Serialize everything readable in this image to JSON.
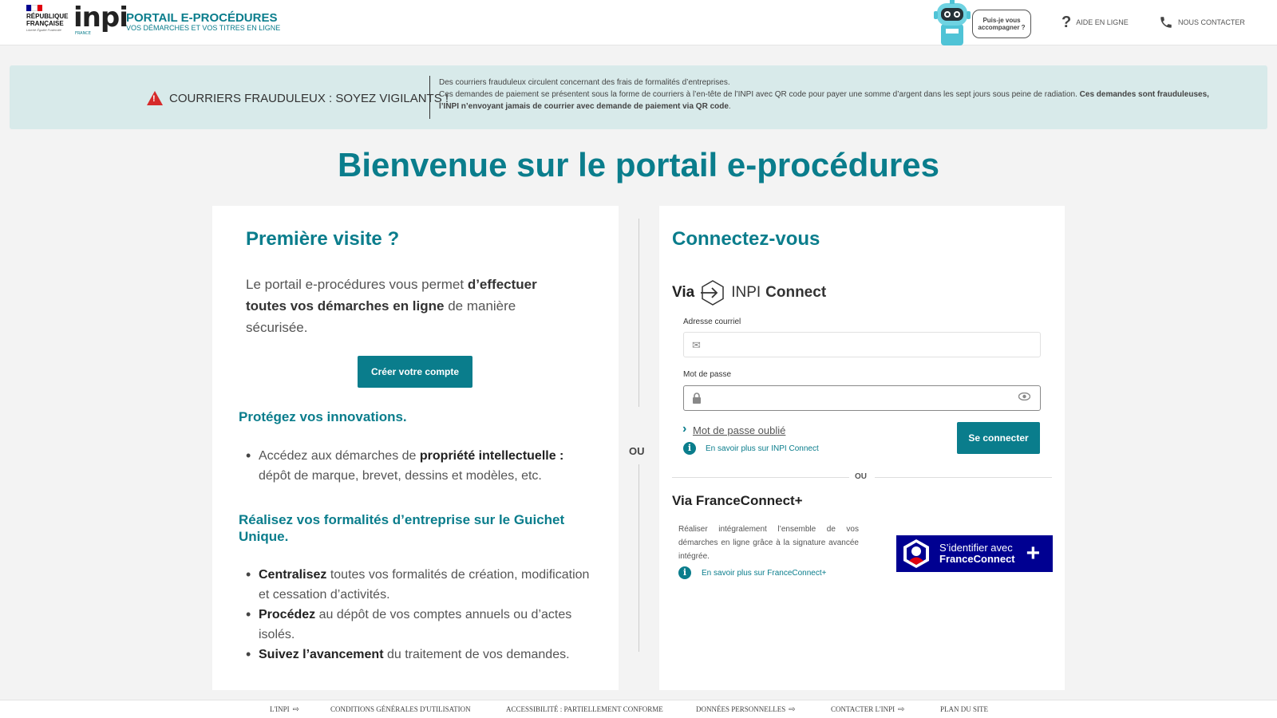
{
  "header": {
    "republique_line1": "RÉPUBLIQUE",
    "republique_line2": "FRANÇAISE",
    "motto": "Liberté Égalité Fraternité",
    "logo_text": "inpi",
    "logo_sub": "FRANCE",
    "portal_title": "PORTAIL E-PROCÉDURES",
    "portal_subtitle": "VOS DÉMARCHES ET VOS TITRES EN LIGNE",
    "assistant_bubble": "Puis-je vous accompagner ?",
    "help_link": "AIDE EN LIGNE",
    "contact_link": "NOUS CONTACTER",
    "help_icon": "question-icon",
    "contact_icon": "phone-icon"
  },
  "alert": {
    "title": "COURRIERS FRAUDULEUX : SOYEZ VIGILANTS !",
    "line1": "Des courriers frauduleux circulent concernant des frais de formalités d’entreprises.",
    "line2": "Ces demandes de paiement se présentent sous la forme de courriers à l’en-tête de l’INPI avec QR code pour payer une somme d’argent dans les sept jours sous peine de radiation.",
    "line2_bold": "Ces demandes sont frauduleuses, l’INPI n’envoyant jamais de courrier avec demande de paiement via QR code",
    "icon": "warning-icon"
  },
  "main_title": "Bienvenue sur le portail e-procédures",
  "left": {
    "title": "Première visite ?",
    "intro_1": "Le portail e-procédures vous permet ",
    "intro_bold": "d’effectuer toutes vos démarches en ligne",
    "intro_2": " de manière sécurisée.",
    "create_button": "Créer votre compte",
    "protect_title": "Protégez vos innovations.",
    "protect_1": "Accédez aux démarches de ",
    "protect_bold": "propriété intellectuelle :",
    "protect_2": " dépôt de marque, brevet, dessins et modèles, etc.",
    "guichet_title": "Réalisez vos formalités d’entreprise sur le Guichet Unique.",
    "items": [
      {
        "bold": "Centralisez",
        "text": " toutes vos formalités de création, modification et cessation d’activités."
      },
      {
        "bold": "Procédez",
        "text": " au dépôt de vos comptes annuels ou d’actes isolés."
      },
      {
        "bold": "Suivez l’avancement",
        "text": " du traitement de vos demandes."
      }
    ]
  },
  "separator_or": "OU",
  "right": {
    "title": "Connectez-vous",
    "via": "Via",
    "inpi_connect_light": "INPI",
    "inpi_connect_bold": "Connect",
    "email_label": "Adresse courriel",
    "email_value": "",
    "password_label": "Mot de passe",
    "password_value": "",
    "forgot": "Mot de passe oublié",
    "learn_inpi": "En savoir plus sur INPI Connect",
    "login_button": "Se connecter",
    "or": "OU",
    "fc_title": "Via FranceConnect+",
    "fc_desc": "Réaliser intégralement l’ensemble de vos démarches en ligne grâce à la signature avancée intégrée.",
    "learn_fc": "En savoir plus sur FranceConnect+",
    "fc_btn_line1": "S’identifier avec",
    "fc_btn_line2": "FranceConnect",
    "fc_btn_plus": "+"
  },
  "footer": {
    "links": [
      "L'INPI",
      "CONDITIONS GÉNÉRALES D'UTILISATION",
      "ACCESSIBILITÉ : PARTIELLEMENT CONFORME",
      "DONNÉES PERSONNELLES",
      "CONTACTER L'INPI",
      "PLAN DU SITE"
    ]
  },
  "colors": {
    "accent": "#0a7d8c",
    "alert_bg": "#d8eaea",
    "warning": "#d62a2a",
    "franceconnect": "#000091"
  }
}
